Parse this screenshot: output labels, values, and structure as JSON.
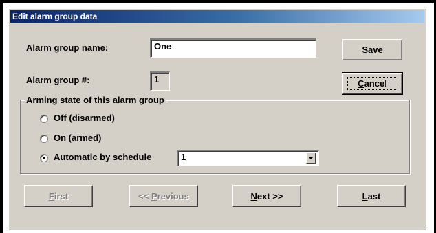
{
  "window": {
    "title": "Edit alarm group data"
  },
  "form": {
    "name_label_first": "A",
    "name_label_rest": "larm group name:",
    "name_value": "One",
    "number_label": "Alarm group #:",
    "number_value": "1"
  },
  "buttons": {
    "save_u": "S",
    "save_rest": "ave",
    "cancel_u": "C",
    "cancel_rest": "ancel",
    "first_u": "F",
    "first_rest": "irst",
    "previous_pre": "<< ",
    "previous_u": "P",
    "previous_rest": "revious",
    "next_u": "N",
    "next_rest": "ext >>",
    "last_u": "L",
    "last_rest": "ast"
  },
  "arming": {
    "group_label_pre": "Arming state ",
    "group_label_u": "o",
    "group_label_rest": "f this alarm group",
    "options": [
      {
        "label": "Off (disarmed)",
        "selected": false
      },
      {
        "label": "On (armed)",
        "selected": false
      },
      {
        "label": "Automatic by schedule",
        "selected": true
      }
    ],
    "schedule_value": "1"
  },
  "icons": {
    "dropdown": "chevron-down-icon",
    "radio_selected": "radio-dot-icon"
  }
}
